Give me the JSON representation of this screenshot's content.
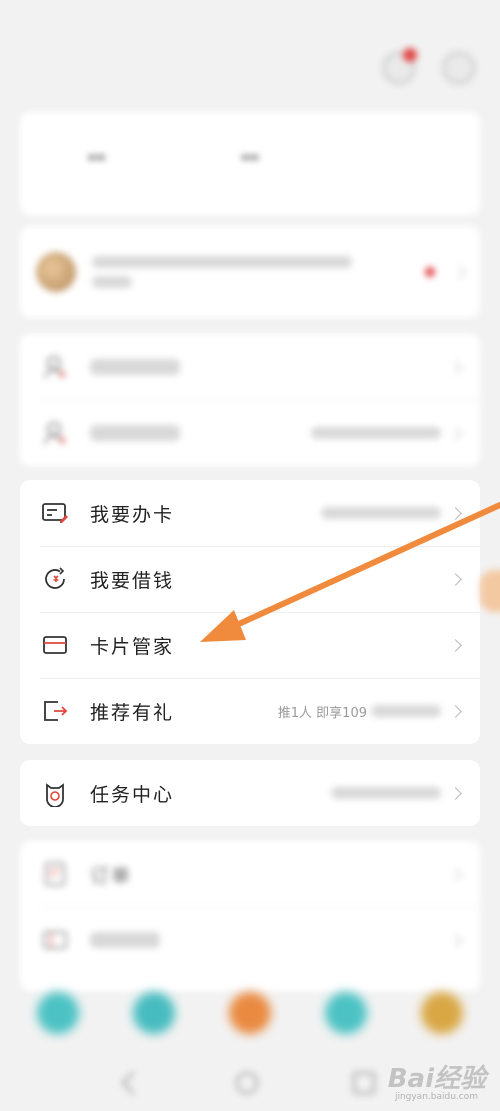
{
  "status_bar": {
    "left": "",
    "right": ""
  },
  "stats": [
    {
      "value": "--",
      "label": ""
    },
    {
      "value": "--",
      "label": ""
    },
    {
      "value": "",
      "label": ""
    }
  ],
  "group2": [
    {
      "label": "我要办卡",
      "sub": "",
      "icon": "card-apply-icon"
    },
    {
      "label": "我要借钱",
      "sub": "",
      "icon": "loan-icon"
    },
    {
      "label": "卡片管家",
      "sub": "",
      "icon": "card-manager-icon"
    },
    {
      "label": "推荐有礼",
      "sub": "推1人 即享109",
      "icon": "share-gift-icon"
    }
  ],
  "group3": [
    {
      "label": "任务中心",
      "sub": "",
      "icon": "task-center-icon"
    }
  ],
  "group4": [
    {
      "label": "订单",
      "icon": "order-icon"
    }
  ],
  "watermark": {
    "main": "Bai经验",
    "sub": "jingyan.baidu.com"
  },
  "colors": {
    "arrow": "#f08a3c",
    "accent_red": "#e0463c",
    "background": "#f2f2f2",
    "card": "#ffffff"
  }
}
